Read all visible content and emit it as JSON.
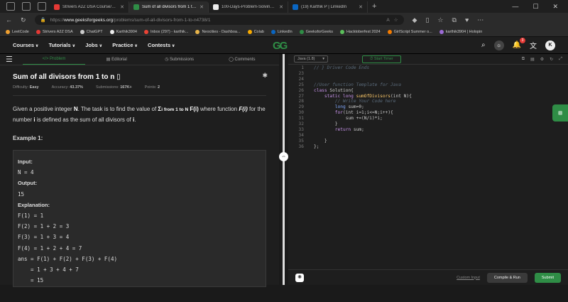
{
  "browser": {
    "tabs": [
      {
        "title": "Strivers A2Z DSA Course/Sheet - ...",
        "favicon_color": "#e53935",
        "active": false
      },
      {
        "title": "Sum of all divisors from 1 to n | P...",
        "favicon_color": "#2f8d46",
        "active": true
      },
      {
        "title": "100-Days-Problem-Solving/Day ...",
        "favicon_color": "#eeeeee",
        "active": false
      },
      {
        "title": "(19) Karthik P | LinkedIn",
        "favicon_color": "#0a66c2",
        "active": false
      }
    ],
    "url_scheme": "https://",
    "url_host": "www.geeksforgeeks.org",
    "url_path": "/problems/sum-of-all-divisors-from-1-to-n4738/1",
    "bookmarks": [
      {
        "label": "LeetCode",
        "color": "#f0a030"
      },
      {
        "label": "Strivers A2Z DSA",
        "color": "#e53935"
      },
      {
        "label": "ChatGPT",
        "color": "#cccccc"
      },
      {
        "label": "Karthik3904",
        "color": "#eeeeee"
      },
      {
        "label": "Inbox (297) - karthik...",
        "color": "#ea4335"
      },
      {
        "label": "Neocities - Dashboa...",
        "color": "#e8b44a"
      },
      {
        "label": "Colab",
        "color": "#f9ab00"
      },
      {
        "label": "LinkedIn",
        "color": "#0a66c2"
      },
      {
        "label": "GeeksforGeeks",
        "color": "#2f8d46"
      },
      {
        "label": "Hacktoberfest 2024",
        "color": "#5bbf5b"
      },
      {
        "label": "GirlScript Summer o...",
        "color": "#f57c00"
      },
      {
        "label": "karthik3904 | Holopin",
        "color": "#9c6bd6"
      }
    ]
  },
  "gfg": {
    "menu": [
      "Courses",
      "Tutorials",
      "Jobs",
      "Practice",
      "Contests"
    ],
    "logo_text": "GG",
    "notification_count": "3",
    "avatar_letter": "K"
  },
  "problem": {
    "tabs": [
      "Problem",
      "Editorial",
      "Submissions",
      "Comments"
    ],
    "title": "Sum of all divisors from 1 to n",
    "meta": {
      "difficulty_label": "Difficulty:",
      "difficulty": "Easy",
      "accuracy_label": "Accuracy:",
      "accuracy": "43.37%",
      "submissions_label": "Submissions:",
      "submissions": "167K+",
      "points_label": "Points:",
      "points": "2"
    },
    "desc_1": "Given a positive integer ",
    "desc_N": "N",
    "desc_2": ". The task is to find the value of ",
    "desc_sigma": "Σ",
    "desc_sub": "i from 1 to N",
    "desc_F": " F(i)",
    "desc_3": " where function ",
    "desc_Fi": "F(i)",
    "desc_4": " for the number ",
    "desc_i": "i",
    "desc_5": " is defined as the sum of all divisors of ",
    "desc_i2": "i",
    "desc_6": ".",
    "example_label": "Example 1:",
    "example": {
      "input_label": "Input:",
      "input": "N = 4",
      "output_label": "Output:",
      "output": "15",
      "explanation_label": "Explanation:",
      "lines": [
        "F(1) = 1",
        "F(2) = 1 + 2 = 3",
        "F(3) = 1 + 3 = 4",
        "F(4) = 1 + 2 + 4 = 7",
        "ans = F(1) + F(2) + F(3) + F(4)",
        "    = 1 + 3 + 4 + 7",
        "    = 15"
      ]
    }
  },
  "editor": {
    "language": "Java (1.8)",
    "timer_label": "Start Timer",
    "line_numbers": [
      "1",
      "23",
      "24",
      "25",
      "26",
      "27",
      "28",
      "29",
      "30",
      "31",
      "32",
      "33",
      "34",
      "35",
      "36"
    ],
    "code": {
      "l1": "// } Driver Code Ends",
      "l25": "//User function Template for Java",
      "l26_kw": "class",
      "l26_name": " Solution{",
      "l27_kw": "    static long ",
      "l27_fn": "sumOfDivisors",
      "l27_rest": "(int N){",
      "l28": "        // Write Your Code here",
      "l29_kw": "        long ",
      "l29_rest": "sum=0;",
      "l30_kw": "        for",
      "l30_rest": "(int i=1;i<=N;i++){",
      "l31": "            sum +=(N/i)*i;",
      "l32": "        }",
      "l33_kw": "        return ",
      "l33_rest": "sum;",
      "l35": "    }",
      "l36": "};"
    },
    "custom_input": "Custom Input",
    "compile_run": "Compile & Run",
    "submit": "Submit"
  }
}
